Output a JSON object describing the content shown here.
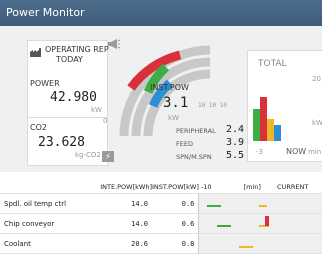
{
  "window": {
    "title": "Power Monitor"
  },
  "operating": {
    "line1": "OPERATING REP",
    "line2": "TODAY"
  },
  "power": {
    "label": "POWER",
    "value": "42.980",
    "unit": "kW",
    "min_tick": "0"
  },
  "co2": {
    "label": "CO2",
    "value": "23.628",
    "unit": "kg-CO2"
  },
  "gauge": {
    "inst_label": "INST.POW",
    "inst_value": "3.1",
    "scale_ticks": "10  10  10",
    "inst_unit": "kW",
    "rows": [
      {
        "label": "PERIPHERAL",
        "value": "2.4"
      },
      {
        "label": "FEED",
        "value": "3.9"
      },
      {
        "label": "SPN/M.SPN",
        "value": "5.5"
      }
    ],
    "colors": {
      "red": "#d9303a",
      "green": "#3cae44",
      "blue": "#2b8fd6",
      "track": "#c8c8c8"
    }
  },
  "total": {
    "title": "TOTAL",
    "top_tick": "20",
    "unit": "kW",
    "axis_left": "-3",
    "now_label": "NOW",
    "min_label": "min",
    "bars": [
      {
        "level": 0.55,
        "color": "#3cae44"
      },
      {
        "level": 0.75,
        "color": "#d9303a"
      },
      {
        "level": 0.38,
        "color": "#f0b62a"
      },
      {
        "level": 0.28,
        "color": "#2b8fd6"
      }
    ]
  },
  "table": {
    "columns": {
      "inst_pow_kwh": "INTE.POW[kWh]",
      "inst_pow_kw": "INST.POW[kW]",
      "axis_left": "-10",
      "min": "[min]",
      "current": "CURRENT"
    },
    "rows": [
      {
        "name": "Spdl. oil temp ctrl",
        "kwh": "14.0",
        "kw": "0.6"
      },
      {
        "name": "Chip conveyor",
        "kwh": "14.0",
        "kw": "0.6"
      },
      {
        "name": "Coolant",
        "kwh": "20.6",
        "kw": "0.8"
      }
    ]
  }
}
